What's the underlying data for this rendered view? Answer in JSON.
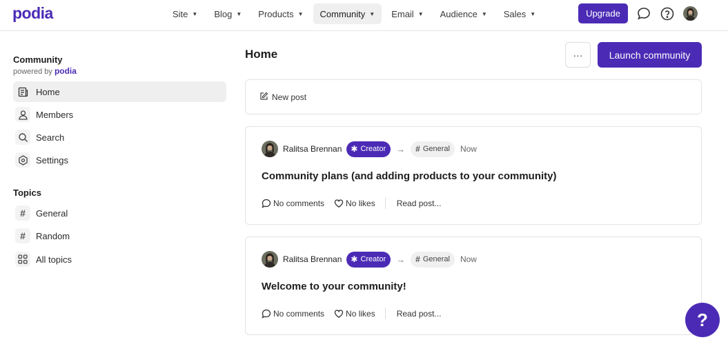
{
  "brand": {
    "logo_text": "podia",
    "accent_color": "#4b2bb5"
  },
  "topnav": {
    "items": [
      {
        "label": "Site"
      },
      {
        "label": "Blog"
      },
      {
        "label": "Products"
      },
      {
        "label": "Community",
        "active": true
      },
      {
        "label": "Email"
      },
      {
        "label": "Audience"
      },
      {
        "label": "Sales"
      }
    ],
    "upgrade_label": "Upgrade",
    "icons": [
      "chat-bubble-icon",
      "help-circle-icon",
      "user-avatar"
    ]
  },
  "sidebar": {
    "title": "Community",
    "powered_by": "powered by",
    "powered_logo": "podia",
    "items": [
      {
        "label": "Home",
        "icon": "home-feed-icon",
        "active": true
      },
      {
        "label": "Members",
        "icon": "person-icon"
      },
      {
        "label": "Search",
        "icon": "search-icon"
      },
      {
        "label": "Settings",
        "icon": "gear-icon"
      }
    ],
    "topics_title": "Topics",
    "topics": [
      {
        "label": "General",
        "icon": "hash-icon"
      },
      {
        "label": "Random",
        "icon": "hash-icon"
      },
      {
        "label": "All topics",
        "icon": "grid-icon"
      }
    ]
  },
  "main": {
    "title": "Home",
    "more_label": "···",
    "launch_label": "Launch community",
    "new_post_label": "New post",
    "posts": [
      {
        "author": "Ralitsa Brennan",
        "badge": "Creator",
        "topic": "General",
        "time": "Now",
        "title": "Community plans (and adding products to your community)",
        "comments": "No comments",
        "likes": "No likes",
        "read": "Read post..."
      },
      {
        "author": "Ralitsa Brennan",
        "badge": "Creator",
        "topic": "General",
        "time": "Now",
        "title": "Welcome to your community!",
        "comments": "No comments",
        "likes": "No likes",
        "read": "Read post..."
      }
    ]
  },
  "help_fab": {
    "label": "?"
  }
}
